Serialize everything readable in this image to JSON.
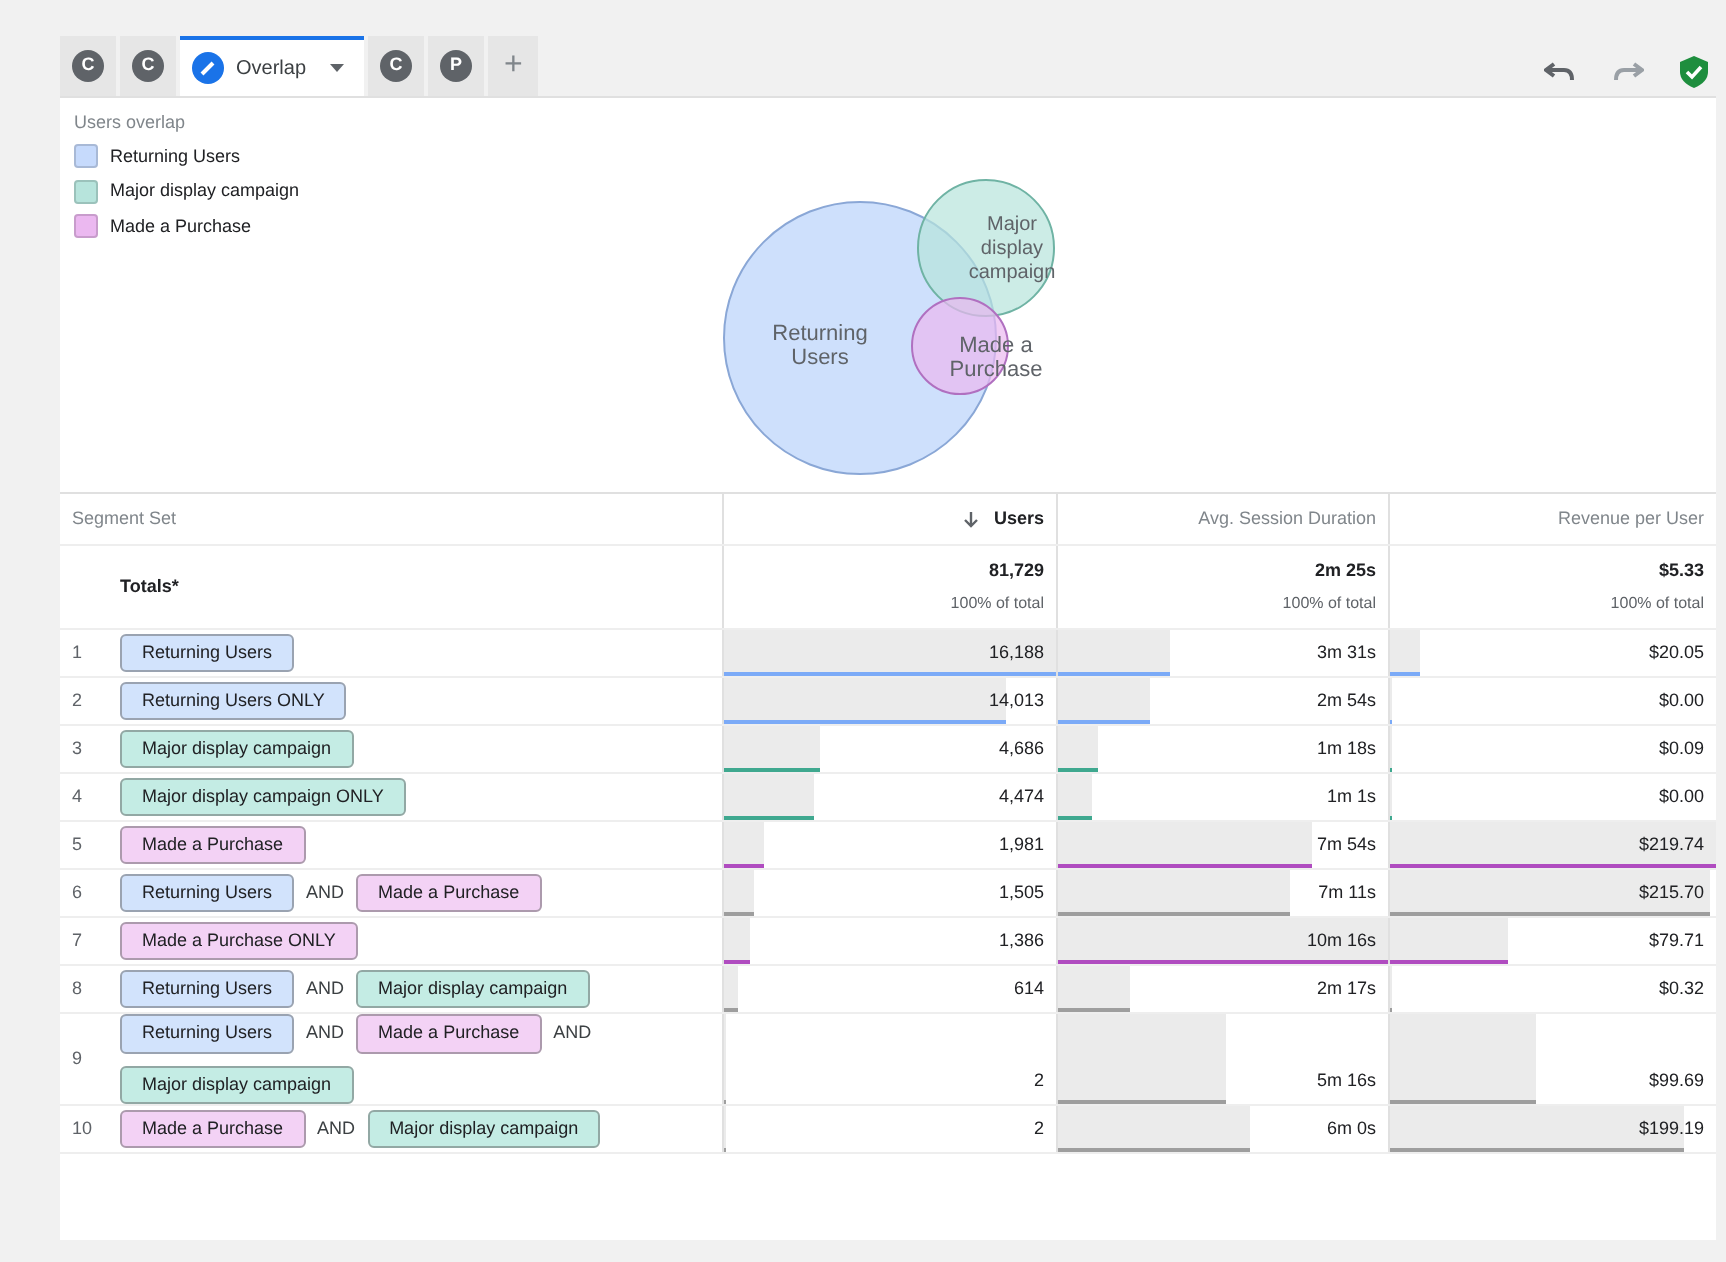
{
  "tabs": [
    {
      "kind": "letter",
      "label": "C",
      "selected": false
    },
    {
      "kind": "letter",
      "label": "C",
      "selected": false
    },
    {
      "kind": "active",
      "label": "Overlap",
      "selected": true
    },
    {
      "kind": "letter",
      "label": "C",
      "selected": false
    },
    {
      "kind": "letter",
      "label": "P",
      "selected": false
    },
    {
      "kind": "add",
      "label": "+",
      "selected": false
    }
  ],
  "overlap": {
    "title": "Users overlap",
    "legend": [
      {
        "label": "Returning Users",
        "color": "#c6dafc"
      },
      {
        "label": "Major display campaign",
        "color": "#b7e4dc"
      },
      {
        "label": "Made a Purchase",
        "color": "#ebb8f0"
      }
    ],
    "venn_labels": [
      "Returning Users",
      "Major display campaign",
      "Made a Purchase"
    ]
  },
  "table": {
    "columns": [
      {
        "label": "Segment Set",
        "sorted": false
      },
      {
        "label": "Users",
        "sorted": true
      },
      {
        "label": "Avg. Session Duration",
        "sorted": false
      },
      {
        "label": "Revenue per User",
        "sorted": false
      }
    ],
    "totals": {
      "label": "Totals*",
      "values": [
        {
          "value": "81,729",
          "share": "100% of total"
        },
        {
          "value": "2m 25s",
          "share": "100% of total"
        },
        {
          "value": "$5.33",
          "share": "100% of total"
        }
      ]
    },
    "rows": [
      {
        "index": "1",
        "color": "#7baaf7",
        "cells": [
          {
            "segments": [
              {
                "kind": "segment",
                "label": "Returning Users",
                "color": "#d2e3fc"
              }
            ]
          },
          {
            "value": "16,188",
            "level": 1
          },
          {
            "value": "3m 31s",
            "level": 0.34
          },
          {
            "value": "$20.05",
            "level": 0.09
          }
        ]
      },
      {
        "index": "2",
        "color": "#7baaf7",
        "cells": [
          {
            "segments": [
              {
                "kind": "segment",
                "label": "Returning Users ONLY",
                "color": "#d2e3fc"
              }
            ]
          },
          {
            "value": "14,013",
            "level": 0.85
          },
          {
            "value": "2m 54s",
            "level": 0.28
          },
          {
            "value": "$0.00",
            "level": 0
          }
        ]
      },
      {
        "index": "3",
        "color": "#3fa88f",
        "cells": [
          {
            "segments": [
              {
                "kind": "segment",
                "label": "Major display campaign",
                "color": "#c4ece4"
              }
            ]
          },
          {
            "value": "4,686",
            "level": 0.29
          },
          {
            "value": "1m 18s",
            "level": 0.12
          },
          {
            "value": "$0.09",
            "level": 0
          }
        ]
      },
      {
        "index": "4",
        "color": "#3fa88f",
        "cells": [
          {
            "segments": [
              {
                "kind": "segment",
                "label": "Major display campaign ONLY",
                "color": "#c4ece4"
              }
            ]
          },
          {
            "value": "4,474",
            "level": 0.27
          },
          {
            "value": "1m 1s",
            "level": 0.1
          },
          {
            "value": "$0.00",
            "level": 0
          }
        ]
      },
      {
        "index": "5",
        "color": "#b04cc0",
        "cells": [
          {
            "segments": [
              {
                "kind": "segment",
                "label": "Made a Purchase",
                "color": "#f3d2f5"
              }
            ]
          },
          {
            "value": "1,981",
            "level": 0.12
          },
          {
            "value": "7m 54s",
            "level": 0.77
          },
          {
            "value": "$219.74",
            "level": 1
          }
        ]
      },
      {
        "index": "6",
        "color": "#9e9e9e",
        "cells": [
          {
            "segments": [
              {
                "kind": "segment",
                "label": "Returning Users",
                "color": "#d2e3fc"
              },
              {
                "kind": "operator",
                "label": "AND"
              },
              {
                "kind": "segment",
                "label": "Made a Purchase",
                "color": "#f3d2f5"
              }
            ]
          },
          {
            "value": "1,505",
            "level": 0.09
          },
          {
            "value": "7m 11s",
            "level": 0.7
          },
          {
            "value": "$215.70",
            "level": 0.98
          }
        ]
      },
      {
        "index": "7",
        "color": "#b04cc0",
        "cells": [
          {
            "segments": [
              {
                "kind": "segment",
                "label": "Made a Purchase ONLY",
                "color": "#f3d2f5"
              }
            ]
          },
          {
            "value": "1,386",
            "level": 0.08
          },
          {
            "value": "10m 16s",
            "level": 1
          },
          {
            "value": "$79.71",
            "level": 0.36
          }
        ]
      },
      {
        "index": "8",
        "color": "#9e9e9e",
        "cells": [
          {
            "segments": [
              {
                "kind": "segment",
                "label": "Returning Users",
                "color": "#d2e3fc"
              },
              {
                "kind": "operator",
                "label": "AND"
              },
              {
                "kind": "segment",
                "label": "Major display campaign",
                "color": "#c4ece4"
              }
            ]
          },
          {
            "value": "614",
            "level": 0.04
          },
          {
            "value": "2m 17s",
            "level": 0.22
          },
          {
            "value": "$0.32",
            "level": 0
          }
        ]
      },
      {
        "index": "9",
        "color": "#9e9e9e",
        "cells": [
          {
            "segments": [
              {
                "kind": "segment",
                "label": "Returning Users",
                "color": "#d2e3fc"
              },
              {
                "kind": "operator",
                "label": "AND"
              },
              {
                "kind": "segment",
                "label": "Made a Purchase",
                "color": "#f3d2f5"
              },
              {
                "kind": "operator",
                "label": "AND"
              },
              {
                "kind": "segment",
                "label": "Major display campaign",
                "color": "#c4ece4"
              }
            ]
          },
          {
            "value": "2",
            "level": 0
          },
          {
            "value": "5m 16s",
            "level": 0.51
          },
          {
            "value": "$99.69",
            "level": 0.45
          }
        ]
      },
      {
        "index": "10",
        "color": "#9e9e9e",
        "cells": [
          {
            "segments": [
              {
                "kind": "segment",
                "label": "Made a Purchase",
                "color": "#f3d2f5"
              },
              {
                "kind": "operator",
                "label": "AND"
              },
              {
                "kind": "segment",
                "label": "Major display campaign",
                "color": "#c4ece4"
              }
            ]
          },
          {
            "value": "2",
            "level": 0
          },
          {
            "value": "6m 0s",
            "level": 0.58
          },
          {
            "value": "$199.19",
            "level": 0.9
          }
        ]
      }
    ]
  }
}
